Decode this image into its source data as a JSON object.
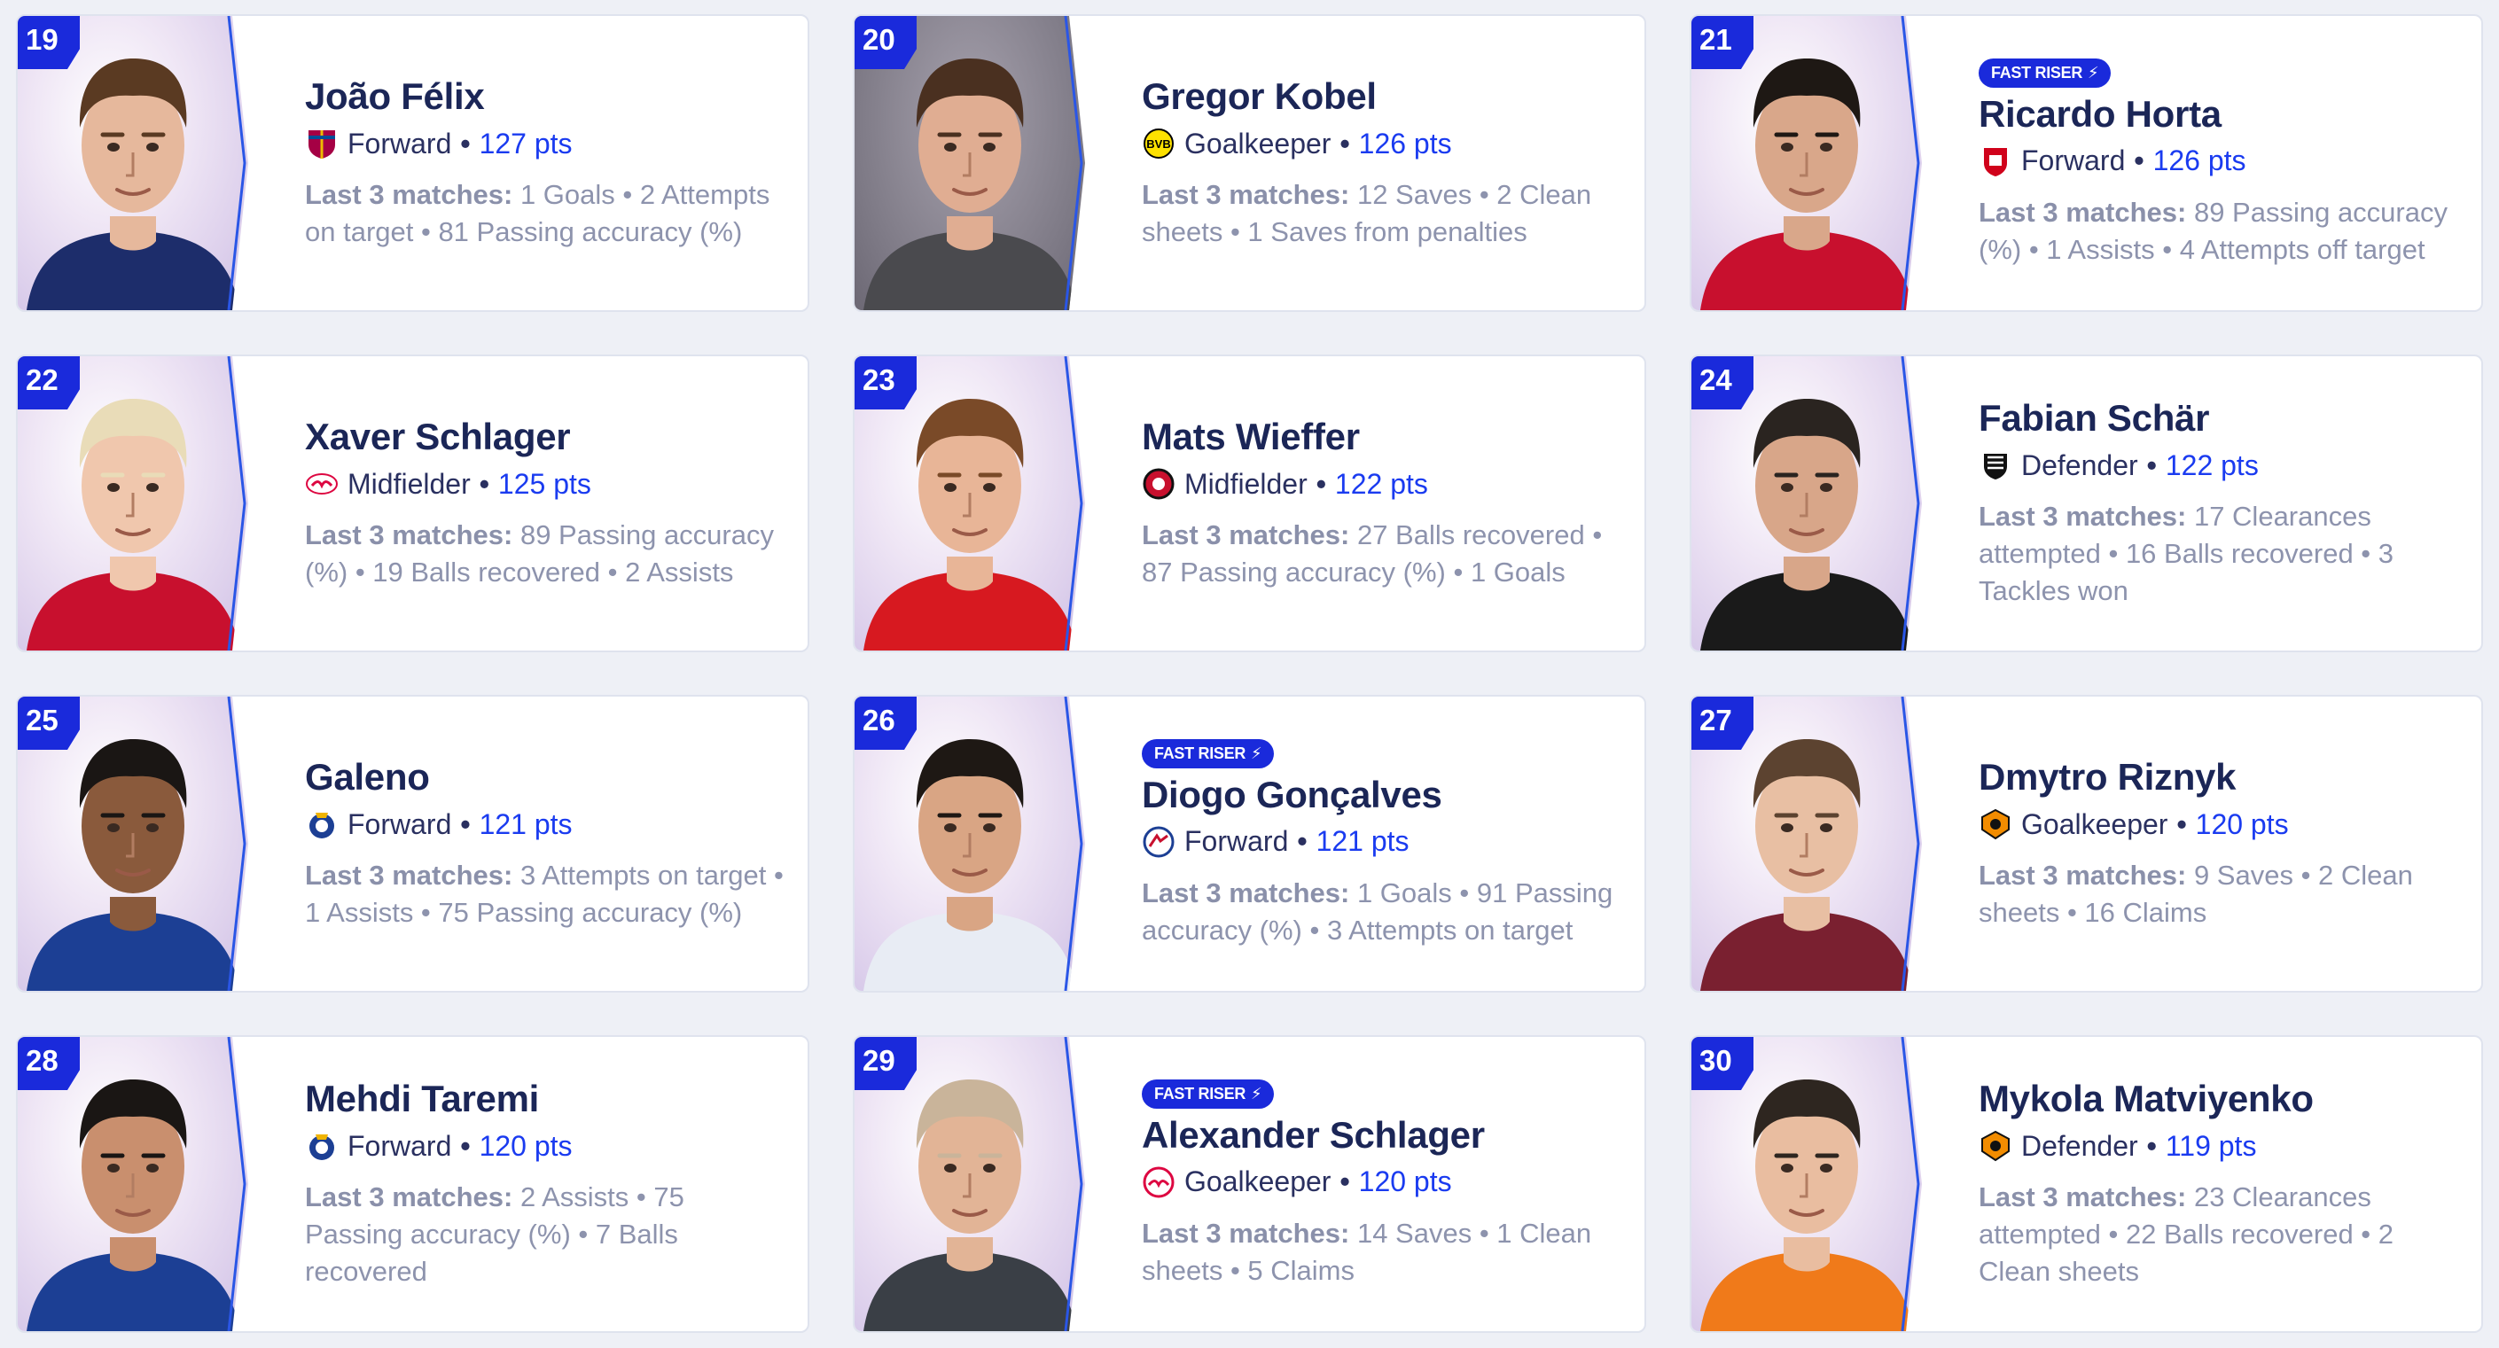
{
  "stats_label": "Last 3 matches:",
  "fast_riser_label": "FAST RISER",
  "accent_color": "#1a2adb",
  "points_color": "#1a3bf0",
  "players": [
    {
      "rank": "19",
      "name": "João Félix",
      "position": "Forward",
      "points": "127 pts",
      "club_icon": "barcelona-crest",
      "fast_riser": false,
      "stats": "1 Goals • 2 Attempts on target • 81 Passing accuracy (%)"
    },
    {
      "rank": "20",
      "name": "Gregor Kobel",
      "position": "Goalkeeper",
      "points": "126 pts",
      "club_icon": "dortmund-crest",
      "fast_riser": false,
      "stats": "12 Saves • 2 Clean sheets • 1 Saves from penalties"
    },
    {
      "rank": "21",
      "name": "Ricardo Horta",
      "position": "Forward",
      "points": "126 pts",
      "club_icon": "braga-crest",
      "fast_riser": true,
      "stats": "89 Passing accuracy (%) • 1 Assists • 4 Attempts off target"
    },
    {
      "rank": "22",
      "name": "Xaver Schlager",
      "position": "Midfielder",
      "points": "125 pts",
      "club_icon": "leipzig-crest",
      "fast_riser": false,
      "stats": "89 Passing accuracy (%) • 19 Balls recovered • 2 Assists"
    },
    {
      "rank": "23",
      "name": "Mats Wieffer",
      "position": "Midfielder",
      "points": "122 pts",
      "club_icon": "feyenoord-crest",
      "fast_riser": false,
      "stats": "27 Balls recovered • 87 Passing accuracy (%) • 1 Goals"
    },
    {
      "rank": "24",
      "name": "Fabian Schär",
      "position": "Defender",
      "points": "122 pts",
      "club_icon": "newcastle-crest",
      "fast_riser": false,
      "stats": "17 Clearances attempted • 16 Balls recovered • 3 Tackles won"
    },
    {
      "rank": "25",
      "name": "Galeno",
      "position": "Forward",
      "points": "121 pts",
      "club_icon": "porto-crest",
      "fast_riser": false,
      "stats": "3 Attempts on target • 1 Assists • 75 Passing accuracy (%)"
    },
    {
      "rank": "26",
      "name": "Diogo Gonçalves",
      "position": "Forward",
      "points": "121 pts",
      "club_icon": "copenhagen-crest",
      "fast_riser": true,
      "stats": "1 Goals • 91 Passing accuracy (%) • 3 Attempts on target"
    },
    {
      "rank": "27",
      "name": "Dmytro Riznyk",
      "position": "Goalkeeper",
      "points": "120 pts",
      "club_icon": "shakhtar-crest",
      "fast_riser": false,
      "stats": "9 Saves • 2 Clean sheets • 16 Claims"
    },
    {
      "rank": "28",
      "name": "Mehdi Taremi",
      "position": "Forward",
      "points": "120 pts",
      "club_icon": "porto-crest",
      "fast_riser": false,
      "stats": "2 Assists • 75 Passing accuracy (%) • 7 Balls recovered"
    },
    {
      "rank": "29",
      "name": "Alexander Schlager",
      "position": "Goalkeeper",
      "points": "120 pts",
      "club_icon": "salzburg-crest",
      "fast_riser": true,
      "stats": "14 Saves • 1 Clean sheets • 5 Claims"
    },
    {
      "rank": "30",
      "name": "Mykola Matviyenko",
      "position": "Defender",
      "points": "119 pts",
      "club_icon": "shakhtar-crest",
      "fast_riser": false,
      "stats": "23 Clearances attempted • 22 Balls recovered • 2 Clean sheets"
    }
  ]
}
